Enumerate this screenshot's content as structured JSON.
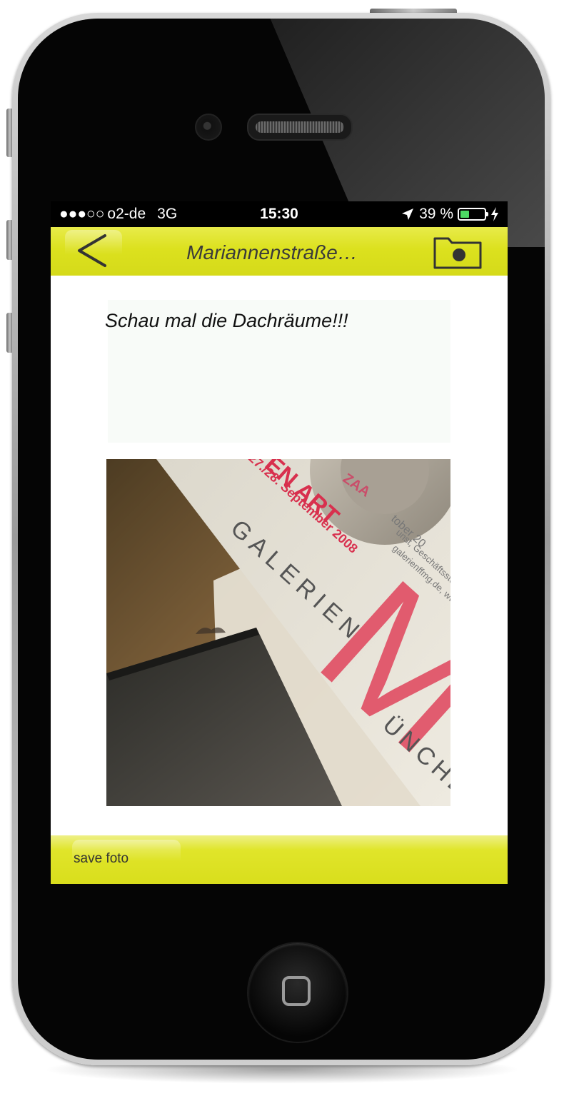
{
  "status_bar": {
    "signal": "●●●○○",
    "carrier": "o2-de",
    "network": "3G",
    "time": "15:30",
    "battery_text": "39 %",
    "battery_level": 0.39,
    "battery_color": "#4cd964"
  },
  "nav": {
    "back_icon": "chevron-left-icon",
    "title": "Mariannenstraße…",
    "camera_icon": "camera-icon",
    "bar_color": "#dce11e"
  },
  "message": {
    "text": "Schau mal die Dachräume!!!"
  },
  "photo": {
    "poster_header": "EN ART",
    "poster_dates": "27./28. September 2008",
    "poster_text_1": "GALERIEN",
    "poster_letter": "M",
    "poster_text_2": "ÜNCHEN",
    "poster_side_1": "tober 20",
    "poster_side_2": "unst, Geschäftsstelle: Bu",
    "poster_side_3": "galerienffmg.de, www.muenc",
    "tape_text": "ZAA"
  },
  "toolbar": {
    "save_label": "save foto"
  }
}
